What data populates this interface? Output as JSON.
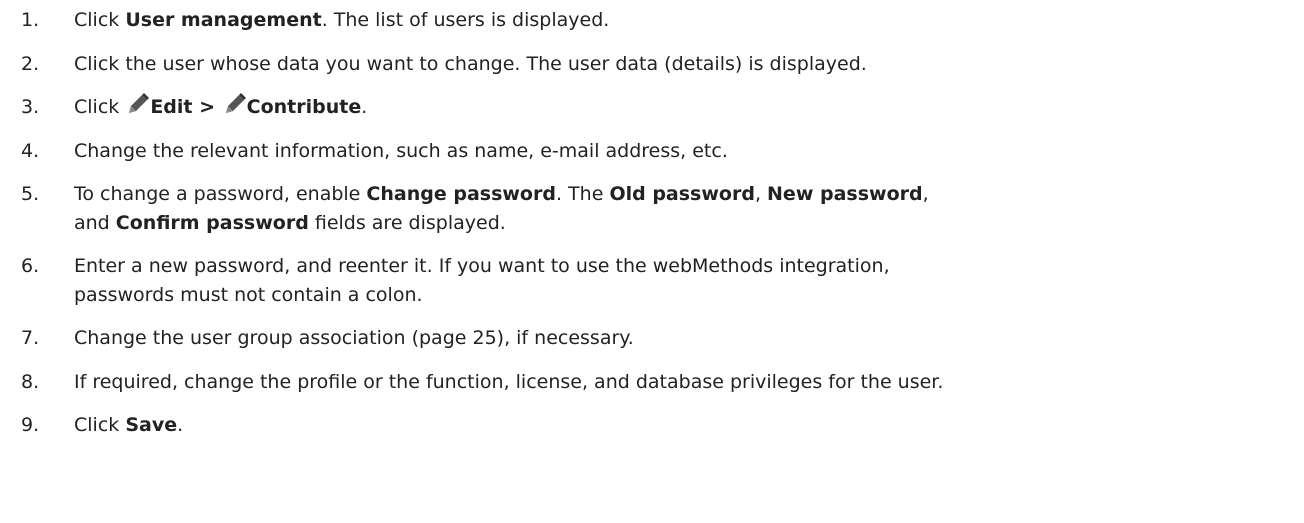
{
  "steps": [
    {
      "number": "1.",
      "parts": [
        "Click ",
        "User management",
        ". The list of users is displayed."
      ]
    },
    {
      "number": "2.",
      "text": "Click the user whose data you want to change. The user data (details) is displayed."
    },
    {
      "number": "3.",
      "parts": [
        "Click ",
        "Edit > ",
        "Contribute",
        "."
      ],
      "icons": [
        "edit-pencil-icon",
        "contribute-pencil-icon"
      ]
    },
    {
      "number": "4.",
      "text": "Change the relevant information, such as name, e-mail address, etc."
    },
    {
      "number": "5.",
      "parts": [
        "To change a password, enable ",
        "Change password",
        ". The ",
        "Old password",
        ", ",
        "New password",
        ",",
        "and ",
        "Confirm password",
        " fields are displayed."
      ]
    },
    {
      "number": "6.",
      "lines": [
        "Enter a new password, and reenter it. If you want to use the webMethods integration,",
        "passwords must not contain a colon."
      ]
    },
    {
      "number": "7.",
      "text": "Change the user group association (page 25), if necessary."
    },
    {
      "number": "8.",
      "text": "If required, change the profile or the function, license, and database privileges for the user."
    },
    {
      "number": "9.",
      "parts": [
        "Click ",
        "Save",
        "."
      ]
    }
  ]
}
